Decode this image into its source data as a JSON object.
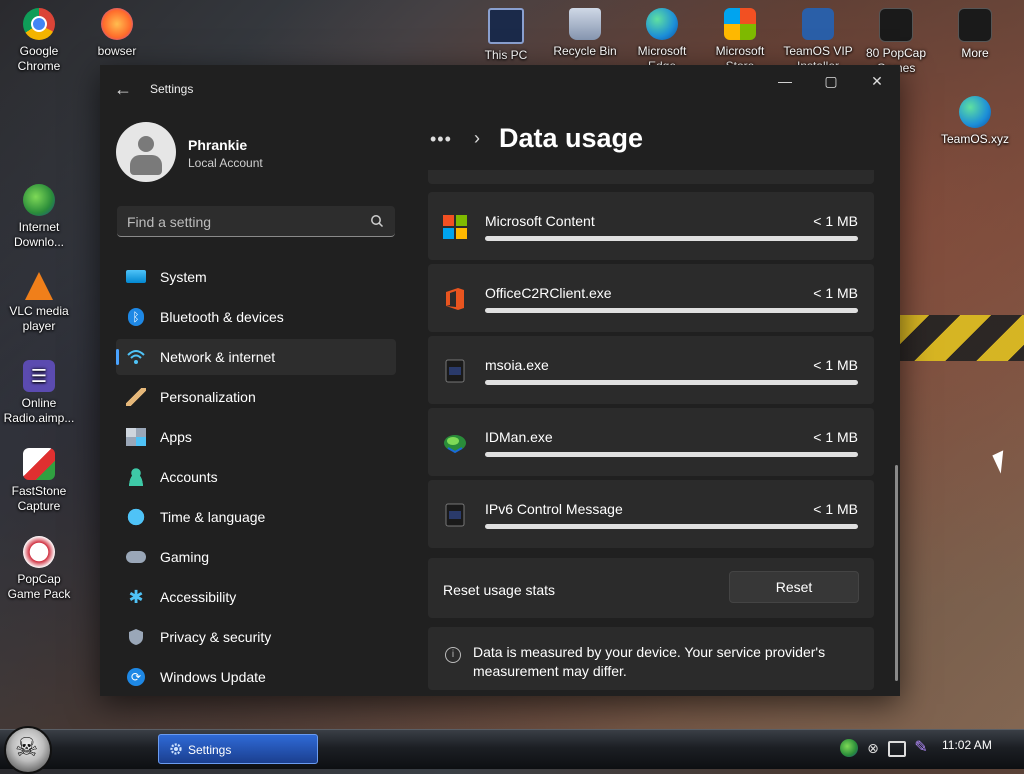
{
  "desktop": {
    "icons": [
      {
        "label": "Google\nChrome",
        "icon": "chrome-icon"
      },
      {
        "label": "bowser",
        "icon": "firefox-icon"
      },
      {
        "label": "Internet\nDownlo...",
        "icon": "idm-icon"
      },
      {
        "label": "VLC media\nplayer",
        "icon": "vlc-icon"
      },
      {
        "label": "Online\nRadio.aimp...",
        "icon": "radio-icon"
      },
      {
        "label": "FastStone\nCapture",
        "icon": "faststone-icon"
      },
      {
        "label": "PopCap\nGame Pack",
        "icon": "popcap-icon"
      },
      {
        "label": "This PC",
        "icon": "computer-icon"
      },
      {
        "label": "Recycle Bin",
        "icon": "recycle-bin-icon"
      },
      {
        "label": "Microsoft\nEdge",
        "icon": "edge-icon"
      },
      {
        "label": "Microsoft\nStore",
        "icon": "store-icon"
      },
      {
        "label": "TeamOS VIP\nInstaller",
        "icon": "installer-icon"
      },
      {
        "label": "80 PopCap\nGames",
        "icon": "popcap-games-icon"
      },
      {
        "label": "More",
        "icon": "more-folder-icon"
      },
      {
        "label": "TeamOS.xyz",
        "icon": "edge-icon"
      }
    ]
  },
  "window": {
    "title": "Settings",
    "controls": {
      "minimize": "—",
      "maximize": "▢",
      "close": "✕"
    }
  },
  "profile": {
    "name": "Phrankie",
    "account_type": "Local Account"
  },
  "search": {
    "placeholder": "Find a setting"
  },
  "nav": [
    {
      "label": "System",
      "icon": "monitor-icon",
      "active": false
    },
    {
      "label": "Bluetooth & devices",
      "icon": "bluetooth-icon",
      "active": false
    },
    {
      "label": "Network & internet",
      "icon": "wifi-icon",
      "active": true
    },
    {
      "label": "Personalization",
      "icon": "brush-icon",
      "active": false
    },
    {
      "label": "Apps",
      "icon": "apps-icon",
      "active": false
    },
    {
      "label": "Accounts",
      "icon": "person-icon",
      "active": false
    },
    {
      "label": "Time & language",
      "icon": "globe-clock-icon",
      "active": false
    },
    {
      "label": "Gaming",
      "icon": "gamepad-icon",
      "active": false
    },
    {
      "label": "Accessibility",
      "icon": "accessibility-icon",
      "active": false
    },
    {
      "label": "Privacy & security",
      "icon": "shield-icon",
      "active": false
    },
    {
      "label": "Windows Update",
      "icon": "update-icon",
      "active": false
    }
  ],
  "breadcrumb": {
    "dots": "•••",
    "chevron": "›",
    "title": "Data usage"
  },
  "apps": [
    {
      "name": "Microsoft Content",
      "size": "< 1 MB",
      "icon": "microsoft-logo-icon"
    },
    {
      "name": "OfficeC2RClient.exe",
      "size": "< 1 MB",
      "icon": "office-icon"
    },
    {
      "name": "msoia.exe",
      "size": "< 1 MB",
      "icon": "exe-icon"
    },
    {
      "name": "IDMan.exe",
      "size": "< 1 MB",
      "icon": "idm-icon"
    },
    {
      "name": "IPv6 Control Message",
      "size": "< 1 MB",
      "icon": "exe-icon"
    }
  ],
  "reset": {
    "label": "Reset usage stats",
    "button": "Reset"
  },
  "info": {
    "text": "Data is measured by your device. Your service provider's measurement may differ."
  },
  "taskbar": {
    "task_label": "Settings",
    "clock": "11:02 AM"
  }
}
